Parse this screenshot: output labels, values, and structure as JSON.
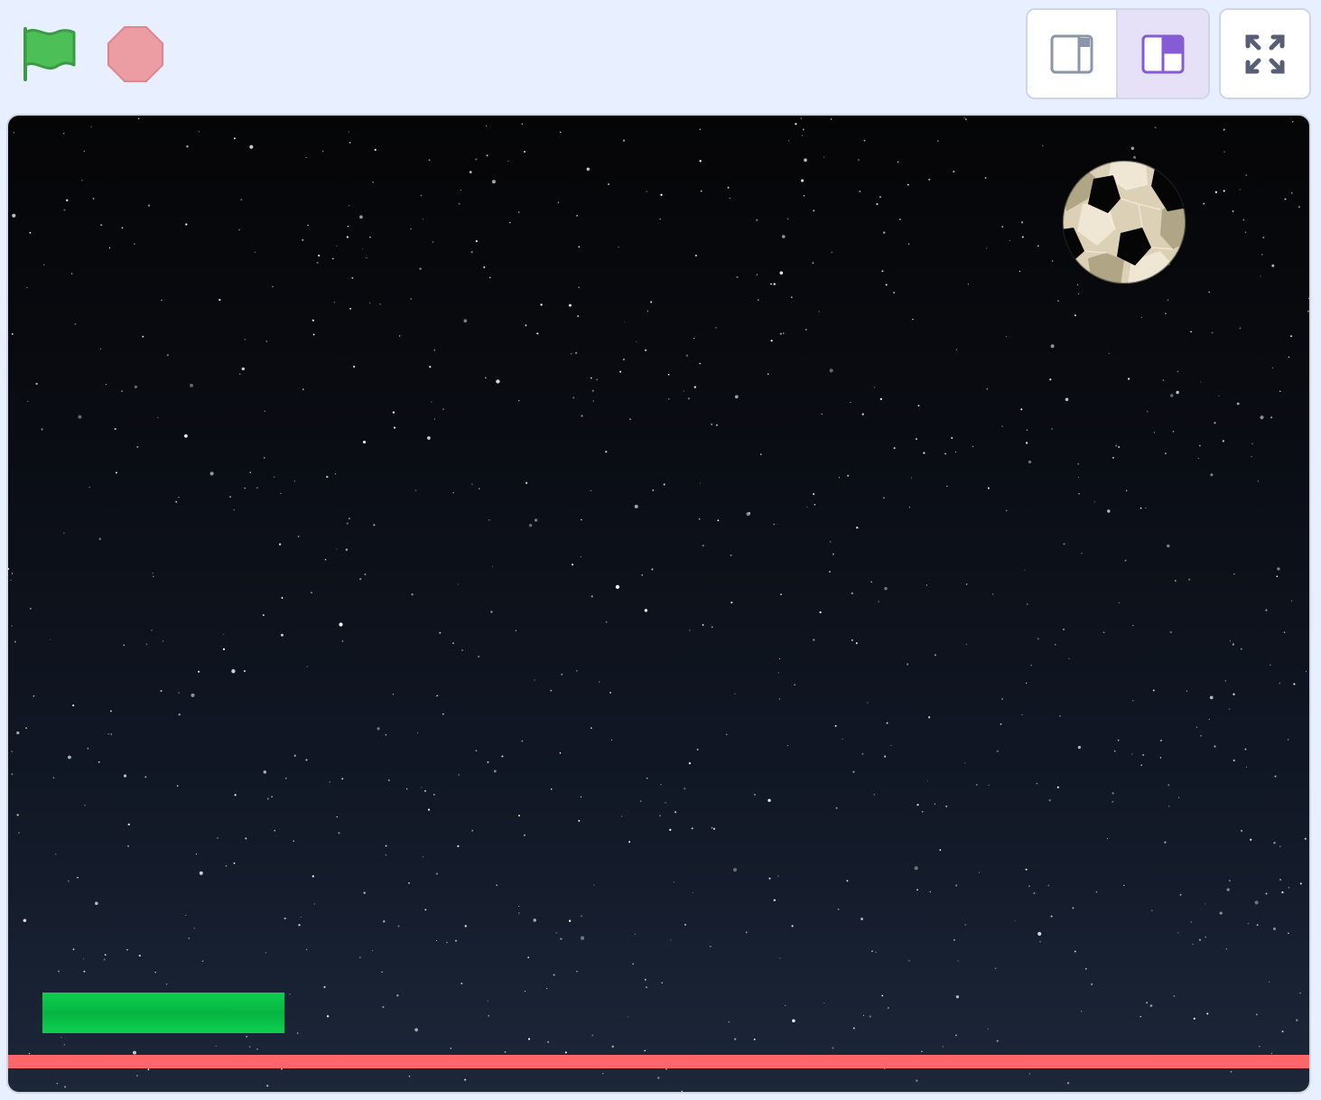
{
  "toolbar": {
    "green_flag_icon": "green-flag-icon",
    "stop_icon": "stop-sign-icon",
    "colors": {
      "flag": "#4cbf56",
      "stop": "#ec9ca3",
      "accent": "#855cd6",
      "background": "#e8f0ff"
    }
  },
  "layout_controls": {
    "small_stage_icon": "small-stage-icon",
    "large_stage_icon": "large-stage-icon",
    "selected": "large-stage",
    "fullscreen_icon": "fullscreen-icon"
  },
  "stage": {
    "backdrop": "stars",
    "sprites": [
      {
        "name": "soccer-ball",
        "icon": "soccer-ball-icon"
      },
      {
        "name": "paddle",
        "color": "#05b543"
      },
      {
        "name": "line",
        "color": "#ff6669"
      }
    ]
  }
}
